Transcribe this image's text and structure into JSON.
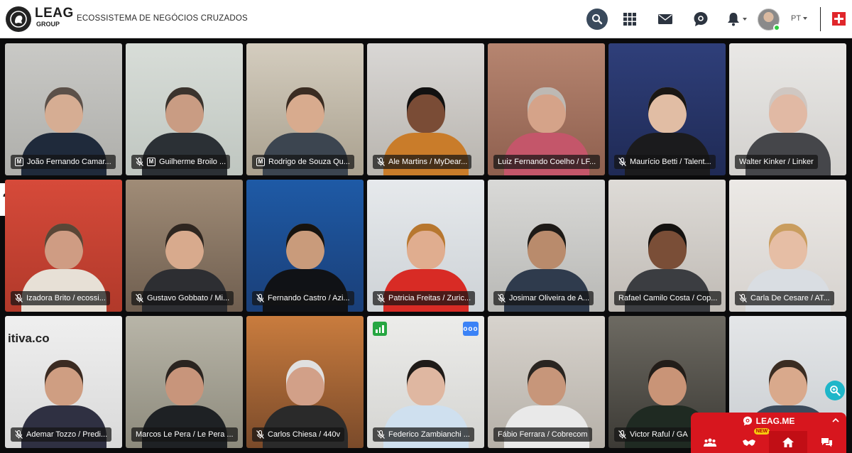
{
  "header": {
    "brand": "LEAG",
    "brand_sub": "GROUP",
    "subtitle": "ECOSSISTEMA DE NEGÓCIOS CRUZADOS",
    "language": "PT",
    "icons": [
      "search-icon",
      "apps-grid-icon",
      "mail-icon",
      "chat-icon",
      "bell-icon",
      "user-avatar",
      "swiss-flag"
    ]
  },
  "colors": {
    "topbar": "#ffffff",
    "background": "#0b0b0c",
    "accent_red": "#d7161e",
    "online_green": "#2ecc40",
    "active_border": "#3a7bd5"
  },
  "participants": [
    {
      "name": "João Fernando Camar...",
      "mic_muted": false,
      "badge": "M"
    },
    {
      "name": "Guilherme Broilo ...",
      "mic_muted": true,
      "badge": "M"
    },
    {
      "name": "Rodrigo de Souza Qu...",
      "mic_muted": false,
      "badge": "M"
    },
    {
      "name": "Ale Martins / MyDear...",
      "mic_muted": true,
      "badge": ""
    },
    {
      "name": "Luiz Fernando Coelho / LF...",
      "mic_muted": false,
      "badge": ""
    },
    {
      "name": "Maurício Betti / Talent...",
      "mic_muted": true,
      "badge": ""
    },
    {
      "name": "Walter Kinker / Linker",
      "mic_muted": false,
      "badge": ""
    },
    {
      "name": "Izadora Brito / ecossi...",
      "mic_muted": true,
      "badge": ""
    },
    {
      "name": "Gustavo Gobbato / Mi...",
      "mic_muted": true,
      "badge": ""
    },
    {
      "name": "Fernando Castro / Azi...",
      "mic_muted": true,
      "badge": ""
    },
    {
      "name": "Patricia Freitas / Zuric...",
      "mic_muted": true,
      "badge": ""
    },
    {
      "name": "Josimar Oliveira de A...",
      "mic_muted": true,
      "badge": ""
    },
    {
      "name": "Rafael Camilo Costa / Cop...",
      "mic_muted": false,
      "badge": ""
    },
    {
      "name": "Carla De Cesare / AT...",
      "mic_muted": true,
      "badge": ""
    },
    {
      "name": "Ademar Tozzo / Predi...",
      "mic_muted": true,
      "badge": ""
    },
    {
      "name": "Marcos Le Pera / Le Pera ...",
      "mic_muted": false,
      "badge": ""
    },
    {
      "name": "Carlos Chiesa / 440v",
      "mic_muted": true,
      "badge": ""
    },
    {
      "name": "Federico Zambianchi ...",
      "mic_muted": true,
      "badge": ""
    },
    {
      "name": "Fábio Ferrara / Cobrecom",
      "mic_muted": false,
      "badge": ""
    },
    {
      "name": "Victor Raful / GA",
      "mic_muted": true,
      "badge": ""
    },
    {
      "name": "",
      "mic_muted": false,
      "badge": ""
    }
  ],
  "tile_texts": {
    "ademar_background": "itiva.co",
    "more_options": "ooo"
  },
  "widget": {
    "title": "LEAG.ME",
    "new_badge": "NEW",
    "buttons": [
      "users-icon",
      "handshake-icon",
      "home-icon",
      "chat-bubbles-icon"
    ]
  }
}
